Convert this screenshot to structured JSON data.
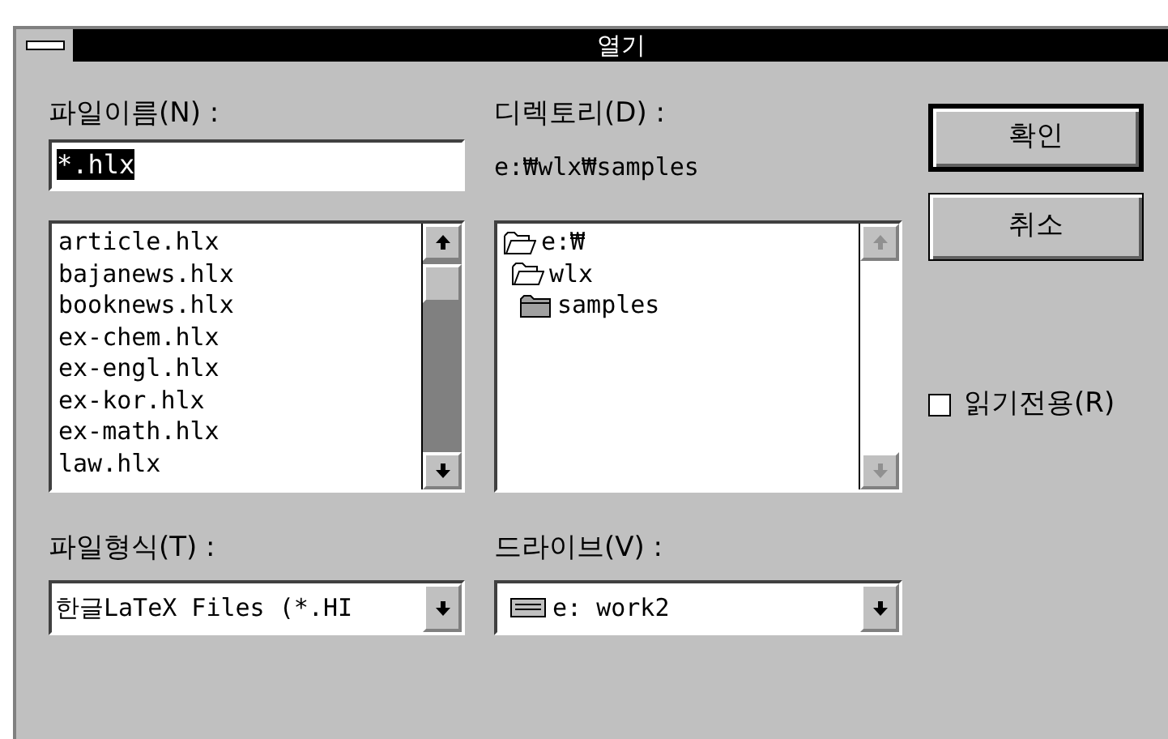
{
  "window": {
    "title": "열기"
  },
  "file_name": {
    "label": "파일이름(N) :",
    "value": "*.hlx",
    "highlighted": true
  },
  "files": {
    "scrollable": true,
    "items": [
      {
        "name": "article.hlx"
      },
      {
        "name": "bajanews.hlx"
      },
      {
        "name": "booknews.hlx"
      },
      {
        "name": "ex-chem.hlx"
      },
      {
        "name": "ex-engl.hlx"
      },
      {
        "name": "ex-kor.hlx"
      },
      {
        "name": "ex-math.hlx"
      },
      {
        "name": "law.hlx"
      }
    ]
  },
  "directory": {
    "label": "디렉토리(D) :",
    "path": "e:₩wlx₩samples",
    "scrollable": false,
    "tree": [
      {
        "name": "e:₩",
        "open": true,
        "children": [
          {
            "name": "wlx",
            "open": true,
            "children": [
              {
                "name": "samples",
                "open": false
              }
            ]
          }
        ]
      }
    ]
  },
  "buttons": [
    {
      "label": "확인",
      "default": true
    },
    {
      "label": "취소",
      "default": false
    }
  ],
  "read_only": {
    "label": "읽기전용(R)",
    "checked": false
  },
  "file_type": {
    "label": "파일형식(T) :",
    "value": "한글LaTeX Files (*.HI"
  },
  "drive": {
    "label": "드라이브(V) :",
    "value": "e: work2"
  }
}
